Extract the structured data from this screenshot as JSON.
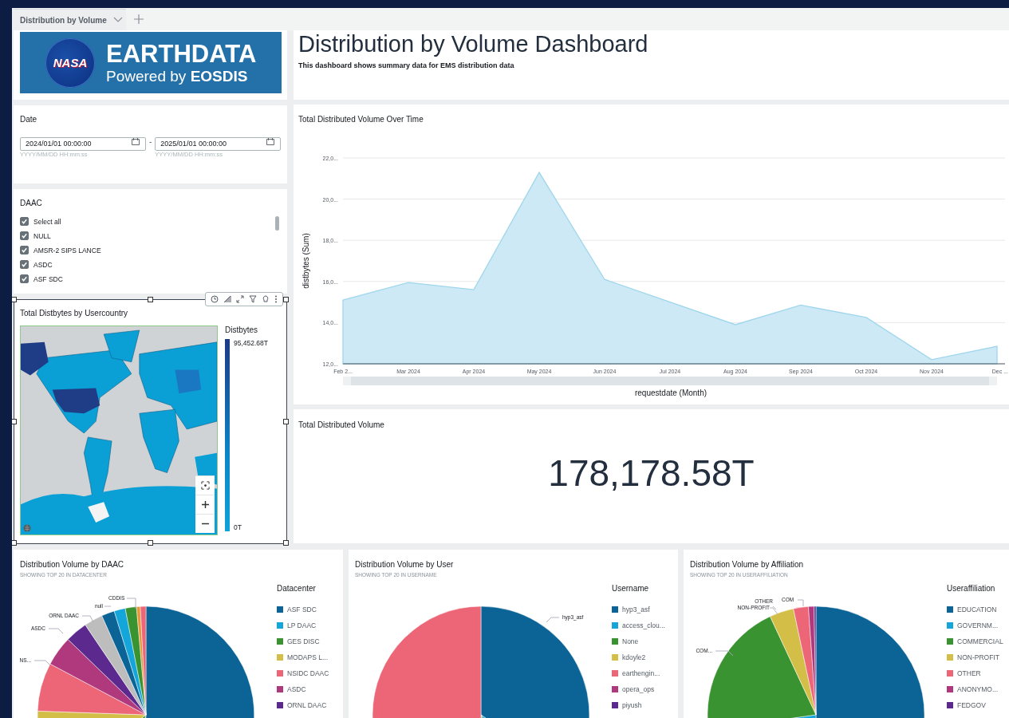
{
  "tabs": [
    {
      "label": "Distribution by Volume",
      "selected": true
    }
  ],
  "logo": {
    "mark": "NASA",
    "title": "EARTHDATA",
    "tagline": "Powered by **EOSDIS**"
  },
  "header": {
    "title": "Distribution by Volume Dashboard",
    "subtitle": "This dashboard shows summary data for EMS distribution data"
  },
  "date_filter": {
    "label": "Date",
    "separator": "-",
    "fields": [
      {
        "value": "2024/01/01 00:00:00",
        "hint": "YYYY/MM/DD HH:mm:ss"
      },
      {
        "value": "2025/01/01 00:00:00",
        "hint": "YYYY/MM/DD HH:mm:ss"
      }
    ]
  },
  "daac_filter": {
    "label": "DAAC",
    "options": [
      {
        "label": "Select all",
        "checked": true
      },
      {
        "label": "NULL",
        "checked": true
      },
      {
        "label": "AMSR-2 SIPS LANCE",
        "checked": true
      },
      {
        "label": "ASDC",
        "checked": true
      },
      {
        "label": "ASF SDC",
        "checked": true
      }
    ]
  },
  "map": {
    "title": "Total Distbytes by Usercountry",
    "legend_title": "Distbytes",
    "max": "95,452.68T",
    "min": "0T"
  },
  "line_chart": {
    "title": "Total Distributed Volume Over Time",
    "x_axis_title": "requestdate (Month)",
    "y_axis_title": "distbytes (Sum)",
    "x_axis_labels": [
      "Feb 2...",
      "Mar 2024",
      "Apr 2024",
      "May 2024",
      "Jun 2024",
      "Jul 2024",
      "Aug 2024",
      "Sep 2024",
      "Oct 2024",
      "Nov 2024",
      "Dec ..."
    ],
    "y_axis_labels": [
      "22,0...",
      "20,0...",
      "18,0...",
      "16,0...",
      "14,0...",
      "12,0..."
    ]
  },
  "kpi": {
    "title": "Total Distributed Volume",
    "value": "178,178.58T"
  },
  "pies": [
    {
      "title": "Distribution Volume by DAAC",
      "subtitle": "SHOWING TOP 20 IN DATACENTER",
      "legend_title": "Datacenter",
      "slice_labels": [
        {
          "text": "CDDIS"
        },
        {
          "text": "null"
        },
        {
          "text": "ORNL DAAC"
        },
        {
          "text": "ASDC"
        },
        {
          "text": "NS..."
        }
      ],
      "legend": [
        {
          "label": "ASF SDC",
          "color": "#0b6396"
        },
        {
          "label": "LP DAAC",
          "color": "#14a6da"
        },
        {
          "label": "GES DISC",
          "color": "#3a9331"
        },
        {
          "label": "MODAPS L...",
          "color": "#d3bf47"
        },
        {
          "label": "NSIDC DAAC",
          "color": "#ec6677"
        },
        {
          "label": "ASDC",
          "color": "#b0387c"
        },
        {
          "label": "ORNL DAAC",
          "color": "#5c2a8e"
        }
      ]
    },
    {
      "title": "Distribution Volume by User",
      "subtitle": "SHOWING TOP 20 IN USERNAME",
      "legend_title": "Username",
      "slice_labels": [
        {
          "text": "hyp3_asf"
        }
      ],
      "legend": [
        {
          "label": "hyp3_asf",
          "color": "#0b6396"
        },
        {
          "label": "access_clou...",
          "color": "#14a6da"
        },
        {
          "label": "None",
          "color": "#3a9331"
        },
        {
          "label": "kdoyle2",
          "color": "#d3bf47"
        },
        {
          "label": "earthengin...",
          "color": "#ec6677"
        },
        {
          "label": "opera_ops",
          "color": "#b0387c"
        },
        {
          "label": "piyush",
          "color": "#5c2a8e"
        }
      ]
    },
    {
      "title": "Distribution Volume by Affiliation",
      "subtitle": "SHOWING TOP 20 IN USERAFFILIATION",
      "legend_title": "Useraffiliation",
      "slice_labels": [
        {
          "text": "OTHER"
        },
        {
          "text": "COM"
        },
        {
          "text": "NON-PROFIT"
        },
        {
          "text": "COM..."
        }
      ],
      "legend": [
        {
          "label": "EDUCATION",
          "color": "#0b6396"
        },
        {
          "label": "GOVERNM...",
          "color": "#14a6da"
        },
        {
          "label": "COMMERCIAL",
          "color": "#3a9331"
        },
        {
          "label": "NON-PROFIT",
          "color": "#d3bf47"
        },
        {
          "label": "OTHER",
          "color": "#ec6677"
        },
        {
          "label": "ANONYMO...",
          "color": "#b0387c"
        },
        {
          "label": "FEDGOV",
          "color": "#5c2a8e"
        }
      ]
    }
  ]
}
